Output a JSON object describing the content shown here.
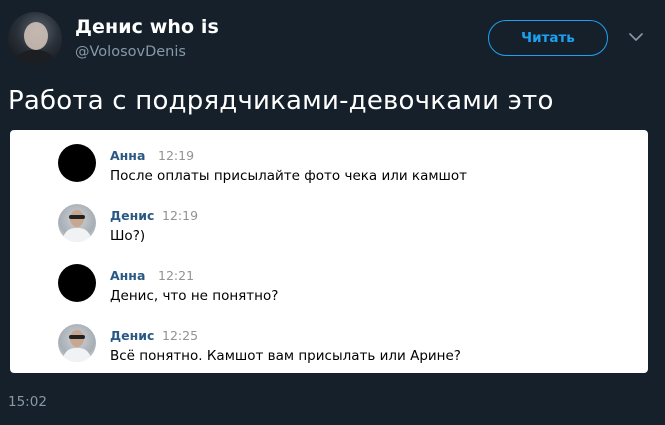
{
  "author": {
    "name": "Денис who is",
    "handle": "@VolosovDenis"
  },
  "follow_label": "Читать",
  "tweet_text": "Работа с подрядчиками-девочками это",
  "messages": [
    {
      "sender": "Анна",
      "time": "12:19",
      "text": "После оплаты присылайте фото чека или камшот",
      "avatar": "black-circle"
    },
    {
      "sender": "Денис",
      "time": "12:19",
      "text": "Шо?)",
      "avatar": "person-photo"
    },
    {
      "sender": "Анна",
      "time": "12:21",
      "text": "Денис, что не понятно?",
      "avatar": "black-circle"
    },
    {
      "sender": "Денис",
      "time": "12:25",
      "text": "Всё понятно. Камшот вам присылать или Арине?",
      "avatar": "person-photo"
    }
  ],
  "tweet_time": "15:02",
  "colors": {
    "background": "#15202b",
    "accent": "#1da1f2",
    "muted": "#8899a6",
    "chat_name": "#2a5885"
  },
  "icons": [
    "chevron-down-icon"
  ]
}
